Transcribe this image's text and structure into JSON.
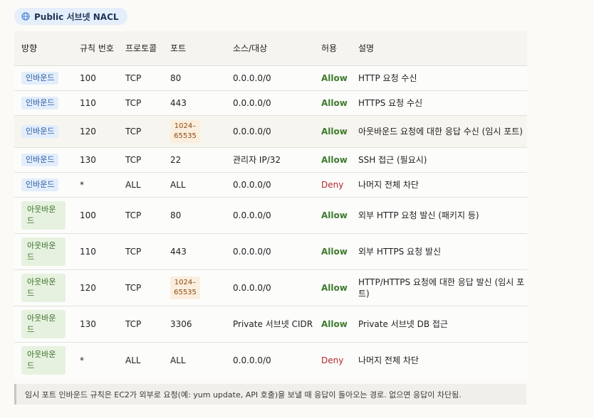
{
  "title": "Public 서브넷 NACL",
  "icons": {
    "title_icon": "globe-icon"
  },
  "colors": {
    "allow": "#3d7b2d",
    "deny": "#b3262d",
    "inbound_badge": "#e3eefc",
    "outbound_badge": "#e6f2df",
    "port_badge": "#fbeedd"
  },
  "headers": [
    "방향",
    "규칙 번호",
    "프로토콜",
    "포트",
    "소스/대상",
    "허용",
    "설명"
  ],
  "rows": [
    {
      "direction": "인바운드",
      "dir_type": "in",
      "rule": "100",
      "protocol": "TCP",
      "port": "80",
      "port_range": false,
      "source": "0.0.0.0/0",
      "action": "Allow",
      "desc": "HTTP 요청 수신"
    },
    {
      "direction": "인바운드",
      "dir_type": "in",
      "rule": "110",
      "protocol": "TCP",
      "port": "443",
      "port_range": false,
      "source": "0.0.0.0/0",
      "action": "Allow",
      "desc": "HTTPS 요청 수신"
    },
    {
      "direction": "인바운드",
      "dir_type": "in",
      "rule": "120",
      "protocol": "TCP",
      "port": "1024–65535",
      "port_range": true,
      "source": "0.0.0.0/0",
      "action": "Allow",
      "desc": "아웃바운드 요청에 대한 응답 수신 (임시 포트)"
    },
    {
      "direction": "인바운드",
      "dir_type": "in",
      "rule": "130",
      "protocol": "TCP",
      "port": "22",
      "port_range": false,
      "source": "관리자 IP/32",
      "action": "Allow",
      "desc": "SSH 접근 (필요시)"
    },
    {
      "direction": "인바운드",
      "dir_type": "in",
      "rule": "*",
      "protocol": "ALL",
      "port": "ALL",
      "port_range": false,
      "source": "0.0.0.0/0",
      "action": "Deny",
      "desc": "나머지 전체 차단"
    },
    {
      "direction": "아웃바운드",
      "dir_type": "out",
      "rule": "100",
      "protocol": "TCP",
      "port": "80",
      "port_range": false,
      "source": "0.0.0.0/0",
      "action": "Allow",
      "desc": "외부 HTTP 요청 발신 (패키지 등)"
    },
    {
      "direction": "아웃바운드",
      "dir_type": "out",
      "rule": "110",
      "protocol": "TCP",
      "port": "443",
      "port_range": false,
      "source": "0.0.0.0/0",
      "action": "Allow",
      "desc": "외부 HTTPS 요청 발신"
    },
    {
      "direction": "아웃바운드",
      "dir_type": "out",
      "rule": "120",
      "protocol": "TCP",
      "port": "1024–65535",
      "port_range": true,
      "source": "0.0.0.0/0",
      "action": "Allow",
      "desc": "HTTP/HTTPS 요청에 대한 응답 발신 (임시 포트)"
    },
    {
      "direction": "아웃바운드",
      "dir_type": "out",
      "rule": "130",
      "protocol": "TCP",
      "port": "3306",
      "port_range": false,
      "source": "Private 서브넷 CIDR",
      "action": "Allow",
      "desc": "Private 서브넷 DB 접근"
    },
    {
      "direction": "아웃바운드",
      "dir_type": "out",
      "rule": "*",
      "protocol": "ALL",
      "port": "ALL",
      "port_range": false,
      "source": "0.0.0.0/0",
      "action": "Deny",
      "desc": "나머지 전체 차단"
    }
  ],
  "note": "임시 포트 인바운드 규칙은 EC2가 외부로 요청(예: yum update, API 호출)을 보낼 때 응답이 돌아오는 경로. 없으면 응답이 차단됨."
}
